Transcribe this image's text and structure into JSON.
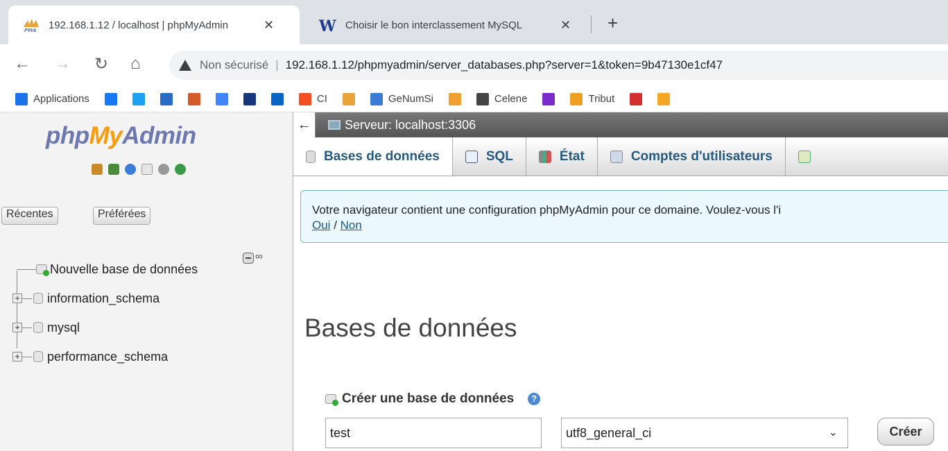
{
  "browser": {
    "tabs": [
      {
        "title": "192.168.1.12 / localhost | phpMyAdmin",
        "favicon": "pma-icon",
        "close": "✕"
      },
      {
        "title": "Choisir le bon interclassement MySQL",
        "favicon": "w-icon",
        "close": "✕"
      }
    ],
    "new_tab": "+",
    "security": "Non sécurisé",
    "url": "192.168.1.12/phpmyadmin/server_databases.php?server=1&token=9b47130e1cf47",
    "bookmarks": [
      {
        "label": "Applications",
        "icon": "apps-grid-icon",
        "color": "#1a73e8"
      },
      {
        "label": "",
        "icon": "facebook-icon",
        "color": "#1877f2"
      },
      {
        "label": "",
        "icon": "twitter-icon",
        "color": "#1da1f2"
      },
      {
        "label": "",
        "icon": "dsm-icon",
        "color": "#2a6cc4"
      },
      {
        "label": "",
        "icon": "pencil-icon",
        "color": "#d45a2a"
      },
      {
        "label": "",
        "icon": "google-icon",
        "color": "#4285f4"
      },
      {
        "label": "",
        "icon": "ge-icon",
        "color": "#16387a"
      },
      {
        "label": "",
        "icon": "outlook-icon",
        "color": "#0a64c2"
      },
      {
        "label": "CI",
        "icon": "ci-icon",
        "color": "#f25022"
      },
      {
        "label": "",
        "icon": "pma-bookmark-icon",
        "color": "#e8a33a"
      },
      {
        "label": "GeNumSi",
        "icon": "genumsi-icon",
        "color": "#3a7bd5"
      },
      {
        "label": "",
        "icon": "trello-icon",
        "color": "#f0a030"
      },
      {
        "label": "Celene",
        "icon": "celene-icon",
        "color": "#444444"
      },
      {
        "label": "",
        "icon": "m-icon",
        "color": "#7a2bc9"
      },
      {
        "label": "Tribut",
        "icon": "tribut-icon",
        "color": "#f0a020"
      },
      {
        "label": "",
        "icon": "shield-red-icon",
        "color": "#d32f2f"
      },
      {
        "label": "",
        "icon": "sti-icon",
        "color": "#f5a623"
      }
    ]
  },
  "pma": {
    "logo": {
      "php": "php",
      "my": "My",
      "admin": "Admin"
    },
    "quick_icons": [
      "home-icon",
      "logout-icon",
      "help-icon",
      "docs-icon",
      "settings-icon",
      "reload-icon"
    ],
    "recent_label": "Récentes",
    "favorites_label": "Préférées",
    "tree": [
      {
        "label": "Nouvelle base de données",
        "icon": "new-db-icon"
      },
      {
        "label": "information_schema",
        "icon": "database-icon"
      },
      {
        "label": "mysql",
        "icon": "database-icon"
      },
      {
        "label": "performance_schema",
        "icon": "database-icon"
      }
    ],
    "server_bar": "Serveur: localhost:3306",
    "menu": [
      {
        "label": "Bases de données",
        "icon": "database-icon"
      },
      {
        "label": "SQL",
        "icon": "sql-icon"
      },
      {
        "label": "État",
        "icon": "status-icon"
      },
      {
        "label": "Comptes d'utilisateurs",
        "icon": "users-icon"
      }
    ],
    "notice": "Votre navigateur contient une configuration phpMyAdmin pour ce domaine. Voulez-vous l'i",
    "notice_yes": "Oui",
    "notice_sep": " / ",
    "notice_no": "Non",
    "page_title": "Bases de données",
    "create_label": "Créer une base de données",
    "help_glyph": "?",
    "db_name_value": "test",
    "collation_value": "utf8_general_ci",
    "create_button": "Créer"
  }
}
